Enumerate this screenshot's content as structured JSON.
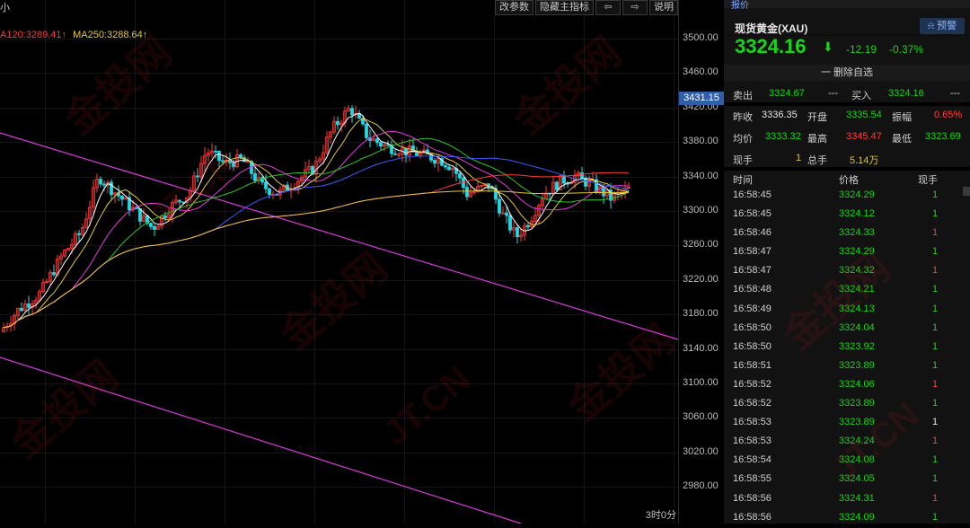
{
  "toolbar": {
    "edit_params": "改参数",
    "hide_main_indicator": "隐藏主指标",
    "prev": "⇦",
    "next": "⇨",
    "help": "说明"
  },
  "chart": {
    "corner_char": "小",
    "ma_legend": [
      {
        "text": "A120:3289.41↑",
        "color": "#ff3a3a"
      },
      {
        "text": "MA250:3288.64↑",
        "color": "#e5c73f"
      }
    ],
    "axis_labels": [
      "3500.00",
      "3460.00",
      "3420.00",
      "3380.00",
      "3340.00",
      "3300.00",
      "3260.00",
      "3220.00",
      "3180.00",
      "3140.00",
      "3100.00",
      "3060.00",
      "3020.00",
      "2980.00"
    ],
    "current_price_label": "3431.15",
    "time_label": "3时0分",
    "channel_color": "#d83adb"
  },
  "panel": {
    "tab": "报价",
    "name": "现货黄金(XAU)",
    "alert": "预警",
    "last_price": "3324.16",
    "change": "-12.19",
    "change_pct": "-0.37%",
    "remove_watch": "一 删除自选",
    "sell_label": "卖出",
    "sell": "3324.67",
    "sell_vol": "---",
    "buy_label": "买入",
    "buy": "3324.16",
    "buy_vol": "---",
    "prev_close_label": "昨收",
    "prev_close": "3336.35",
    "open_label": "开盘",
    "open": "3335.54",
    "amplitude_label": "振幅",
    "amplitude": "0.65%",
    "avg_label": "均价",
    "avg": "3333.32",
    "high_label": "最高",
    "high": "3345.47",
    "low_label": "最低",
    "low": "3323.69",
    "current_vol_label": "现手",
    "current_vol": "1",
    "total_vol_label": "总手",
    "total_vol": "5.14万",
    "ticks_header": {
      "time": "时间",
      "price": "价格",
      "vol": "现手"
    },
    "ticks": [
      {
        "time": "16:58:45",
        "price": "3324.29",
        "vol": "1",
        "vcolor": "g"
      },
      {
        "time": "16:58:45",
        "price": "3324.12",
        "vol": "1",
        "vcolor": "g"
      },
      {
        "time": "16:58:46",
        "price": "3324.33",
        "vol": "1",
        "vcolor": "r"
      },
      {
        "time": "16:58:47",
        "price": "3324.29",
        "vol": "1",
        "vcolor": "g"
      },
      {
        "time": "16:58:47",
        "price": "3324.32",
        "vol": "1",
        "vcolor": "r"
      },
      {
        "time": "16:58:48",
        "price": "3324.21",
        "vol": "1",
        "vcolor": "g"
      },
      {
        "time": "16:58:49",
        "price": "3324.13",
        "vol": "1",
        "vcolor": "g"
      },
      {
        "time": "16:58:50",
        "price": "3324.04",
        "vol": "1",
        "vcolor": "g"
      },
      {
        "time": "16:58:50",
        "price": "3323.92",
        "vol": "1",
        "vcolor": "g"
      },
      {
        "time": "16:58:51",
        "price": "3323.89",
        "vol": "1",
        "vcolor": "g"
      },
      {
        "time": "16:58:52",
        "price": "3324.06",
        "vol": "1",
        "vcolor": "r"
      },
      {
        "time": "16:58:52",
        "price": "3323.89",
        "vol": "1",
        "vcolor": "g"
      },
      {
        "time": "16:58:53",
        "price": "3323.89",
        "vol": "1",
        "vcolor": "w"
      },
      {
        "time": "16:58:53",
        "price": "3324.24",
        "vol": "1",
        "vcolor": "r"
      },
      {
        "time": "16:58:54",
        "price": "3324.08",
        "vol": "1",
        "vcolor": "g"
      },
      {
        "time": "16:58:55",
        "price": "3324.05",
        "vol": "1",
        "vcolor": "g"
      },
      {
        "time": "16:58:56",
        "price": "3324.31",
        "vol": "1",
        "vcolor": "r"
      },
      {
        "time": "16:58:56",
        "price": "3324.09",
        "vol": "1",
        "vcolor": "g"
      }
    ]
  },
  "watermark": {
    "text1": "金投网",
    "text2": "JT.CN"
  }
}
